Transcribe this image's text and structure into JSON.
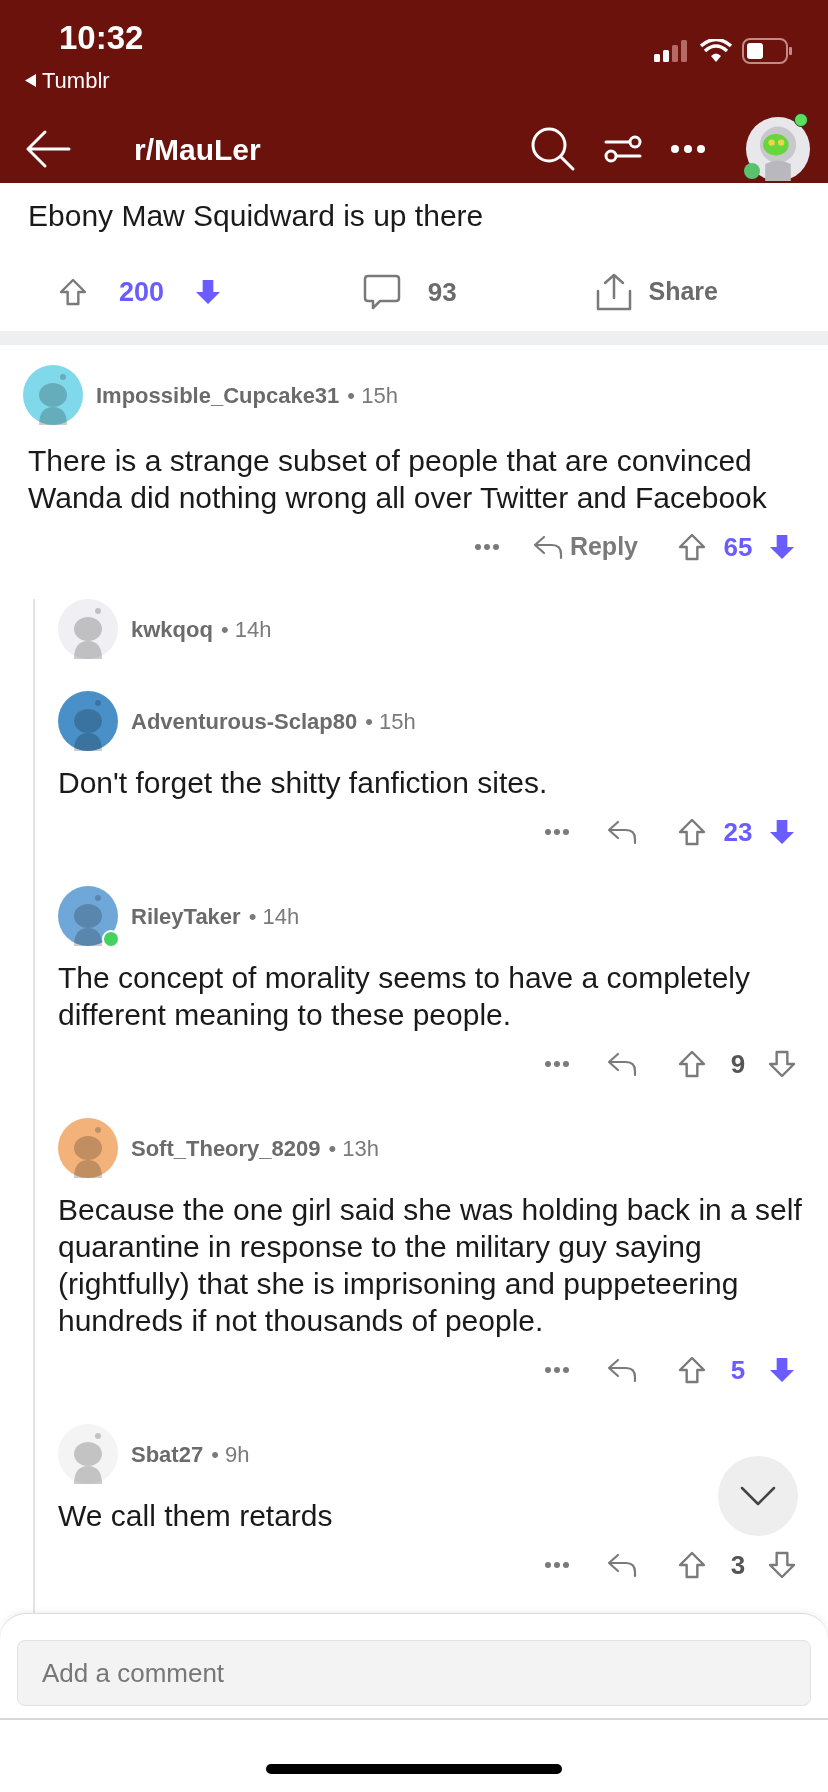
{
  "status_bar": {
    "time": "10:32",
    "back_app": "Tumblr"
  },
  "header": {
    "title": "r/MauLer",
    "avatar_online": true
  },
  "post": {
    "text_tail": "Ebony Maw Squidward is up there",
    "score": "200",
    "downvoted": true,
    "comment_count": "93",
    "share_label": "Share"
  },
  "comments": [
    {
      "author": "Impossible_Cupcake31",
      "time": "• 15h",
      "color": "#7fd9ea",
      "online": false,
      "body": "There is a strange subset of people that are convinced Wanda did nothing wrong all over Twitter and Facebook",
      "reply_label": "Reply",
      "score": "65",
      "downvoted": true,
      "children": [
        {
          "author": "kwkqoq",
          "time": "• 14h",
          "color": "#f0f0f4",
          "online": false
        },
        {
          "author": "Adventurous-Sclap80",
          "time": "• 15h",
          "color": "#4a90c8",
          "online": false,
          "body": "Don't forget the shitty fanfiction sites.",
          "score": "23",
          "downvoted": true
        },
        {
          "author": "RileyTaker",
          "time": "• 14h",
          "color": "#6fa8d8",
          "online": true,
          "body": "The concept of morality seems to have a completely different meaning to these people.",
          "score": "9",
          "downvoted": false
        },
        {
          "author": "Soft_Theory_8209",
          "time": "• 13h",
          "color": "#f2b27a",
          "online": false,
          "body": "Because the one girl said she was holding back in a self quarantine in response to the military guy saying (rightfully) that she is imprisoning and puppeteering hundreds if not thousands of people.",
          "score": "5",
          "downvoted": true
        },
        {
          "author": "Sbat27",
          "time": "• 9h",
          "color": "#f4f4f4",
          "online": false,
          "body": "We call them retards",
          "score": "3",
          "downvoted": false
        }
      ]
    }
  ],
  "composer": {
    "placeholder": "Add a comment"
  }
}
